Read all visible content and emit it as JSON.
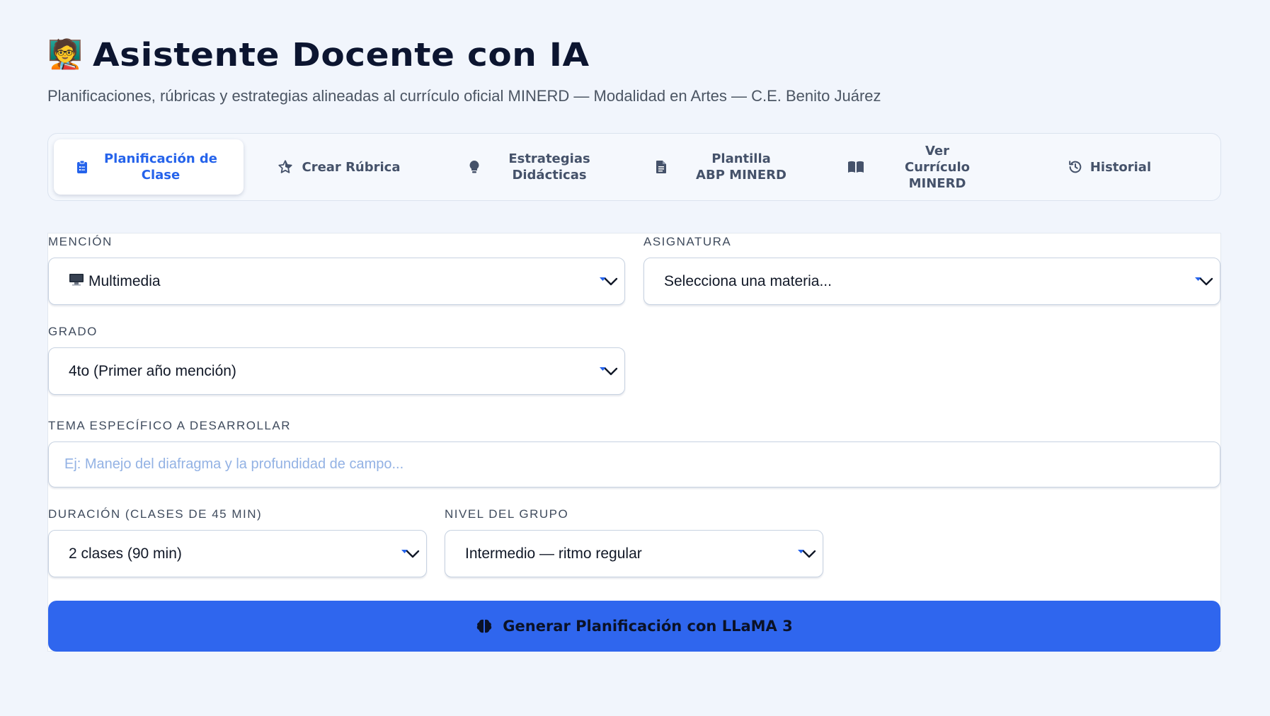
{
  "header": {
    "emoji": "🧑‍🏫",
    "title": "Asistente Docente con IA",
    "subtitle": "Planificaciones, rúbricas y estrategias alineadas al currículo oficial MINERD — Modalidad en Artes — C.E. Benito Juárez"
  },
  "tabs": [
    {
      "label": "Planificación de Clase",
      "icon": "clipboard-icon",
      "active": true
    },
    {
      "label": "Crear Rúbrica",
      "icon": "star-icon",
      "active": false
    },
    {
      "label": "Estrategias Didácticas",
      "icon": "lightbulb-icon",
      "active": false
    },
    {
      "label": "Plantilla ABP MINERD",
      "icon": "document-icon",
      "active": false
    },
    {
      "label": "Ver Currículo MINERD",
      "icon": "book-icon",
      "active": false
    },
    {
      "label": "Historial",
      "icon": "history-icon",
      "active": false
    }
  ],
  "form": {
    "mencion": {
      "label": "MENCIÓN",
      "value": "Multimedia",
      "icon": "monitor-icon"
    },
    "asignatura": {
      "label": "ASIGNATURA",
      "value": "Selecciona una materia..."
    },
    "grado": {
      "label": "GRADO",
      "value": "4to (Primer año mención)"
    },
    "tema": {
      "label": "TEMA ESPECÍFICO A DESARROLLAR",
      "placeholder": "Ej: Manejo del diafragma y la profundidad de campo..."
    },
    "duracion": {
      "label": "DURACIÓN (CLASES DE 45 MIN)",
      "value": "2 clases (90 min)"
    },
    "nivel": {
      "label": "NIVEL DEL GRUPO",
      "value": "Intermedio — ritmo regular"
    },
    "generate_label": "Generar Planificación con LLaMA 3"
  },
  "colors": {
    "accent": "#2563eb",
    "button": "#2f66ee",
    "background": "#f1f5fc",
    "placeholder": "#93b2e4"
  }
}
